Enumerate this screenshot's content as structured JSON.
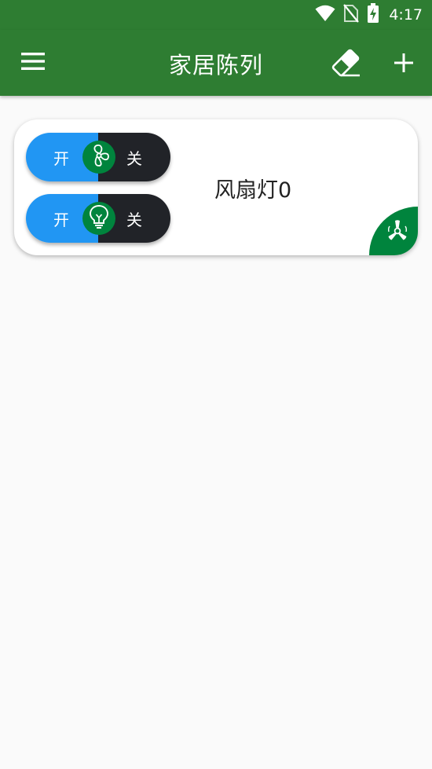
{
  "status_bar": {
    "time": "4:17",
    "icons": [
      "wifi-icon",
      "no-sim-icon",
      "battery-charging-icon"
    ]
  },
  "app_bar": {
    "title": "家居陈列",
    "menu_icon": "menu-icon",
    "eraser_icon": "eraser-icon",
    "add_icon": "plus-icon",
    "color": "#2e7d32"
  },
  "devices": [
    {
      "name": "风扇灯0",
      "controls": [
        {
          "icon": "fan-icon",
          "on_label": "开",
          "off_label": "关"
        },
        {
          "icon": "lightbulb-icon",
          "on_label": "开",
          "off_label": "关"
        }
      ],
      "badge_icon": "fan-device-icon"
    }
  ],
  "colors": {
    "on": "#2196f3",
    "off": "#212328",
    "knob": "#00843d",
    "background": "#fafafa"
  }
}
